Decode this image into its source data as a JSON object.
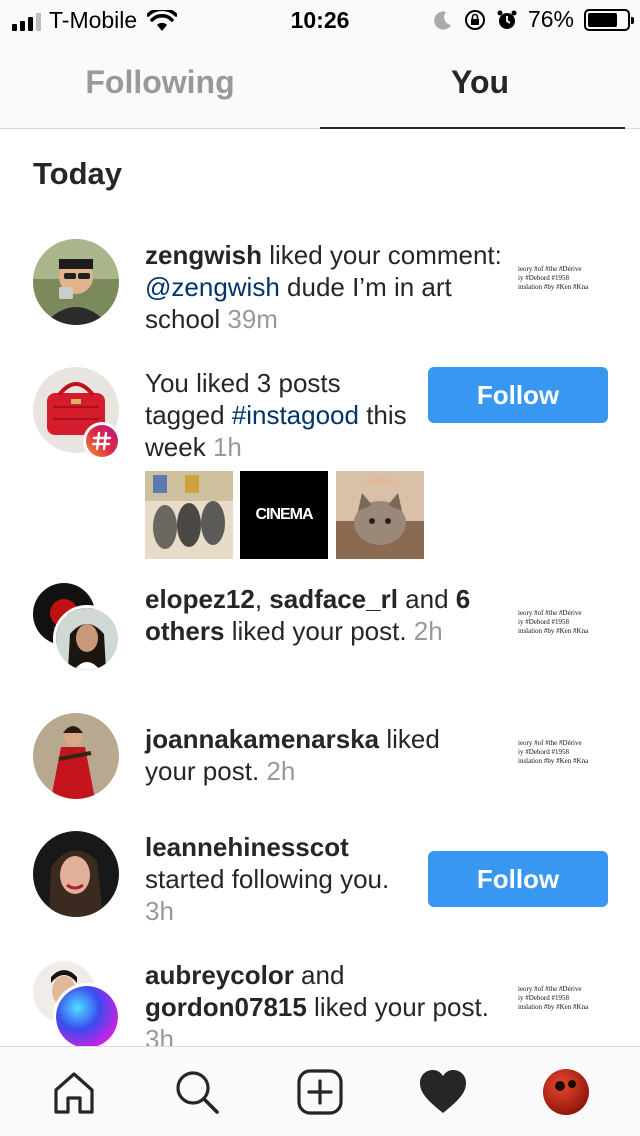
{
  "status_bar": {
    "carrier": "T-Mobile",
    "time": "10:26",
    "battery": "76%",
    "battery_level": 0.76
  },
  "tabs": [
    {
      "label": "Following",
      "active": false
    },
    {
      "label": "You",
      "active": true
    }
  ],
  "section_title": "Today",
  "notifications": [
    {
      "user": "zengwish",
      "text": " liked your comment: ",
      "mention": "@zengwish",
      "text2": " dude I’m in art school",
      "time": "39m"
    },
    {
      "text": "You liked 3 posts tagged ",
      "hashtag": "#instagood",
      "text2": " this week",
      "time": "1h",
      "button": "Follow",
      "thumb_caption": "CINEMA"
    },
    {
      "user": "elopez12",
      "sep": ", ",
      "user2": "sadface_rl",
      "text": " and ",
      "others": "6 others",
      "text2": " liked your post.",
      "time": "2h"
    },
    {
      "user": "joannakamenarska",
      "text": " liked your post.",
      "time": "2h"
    },
    {
      "user": "leannehinesscot",
      "text": " started following you.",
      "time": "3h",
      "button": "Follow"
    },
    {
      "user": "aubreycolor",
      "text": " and ",
      "user2": "gordon07815",
      "text2": " liked your post.",
      "time": "3h"
    }
  ],
  "post_preview_lines": [
    "ieory #of #the #Dérive",
    "iy #Debord #1958",
    "inslation #by #Ken #Kna"
  ],
  "bottom_nav": [
    "home-icon",
    "search-icon",
    "new-post-icon",
    "activity-heart-icon",
    "profile-avatar"
  ],
  "colors": {
    "accent": "#3897f0",
    "link": "#003569",
    "muted": "#999999",
    "text": "#262626"
  }
}
